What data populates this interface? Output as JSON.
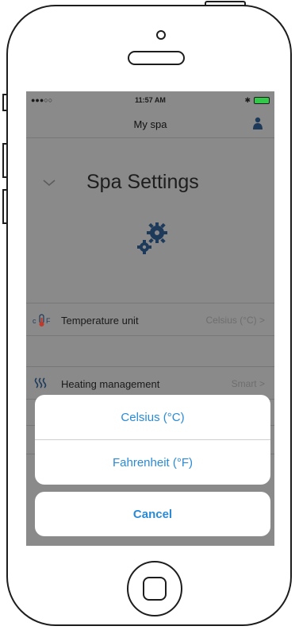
{
  "status_bar": {
    "carrier": "●●●○○",
    "time": "11:57 AM",
    "bluetooth": "✱"
  },
  "nav": {
    "title": "My spa",
    "profile_icon": "person-icon"
  },
  "settings": {
    "title": "Spa Settings",
    "collapse_icon": "chevron-down-icon",
    "section_icon": "gears-icon"
  },
  "rows": [
    {
      "label": "Temperature unit",
      "value": "Celsius (°C) >",
      "icon": "thermometer-cf-icon"
    },
    {
      "label": "Heating management",
      "value": "Smart >",
      "icon": "heat-waves-icon"
    }
  ],
  "action_sheet": {
    "options": [
      "Celsius (°C)",
      "Fahrenheit (°F)"
    ],
    "cancel_label": "Cancel"
  },
  "colors": {
    "accent": "#2a8ad6",
    "overlay": "#8a8a8a",
    "icon_dark": "#1e3a5a"
  }
}
